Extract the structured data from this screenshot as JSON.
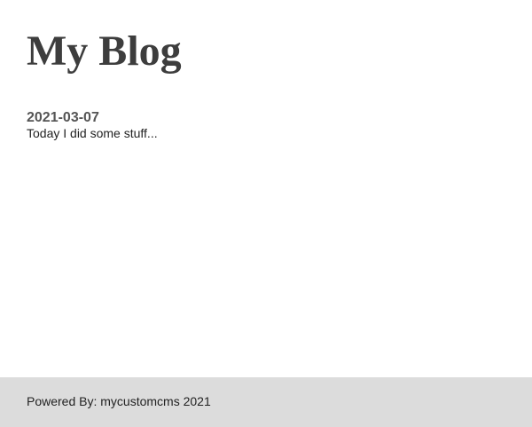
{
  "header": {
    "title": "My Blog"
  },
  "posts": [
    {
      "date": "2021-03-07",
      "body": "Today I did some stuff..."
    }
  ],
  "footer": {
    "text": "Powered By: mycustomcms 2021"
  },
  "colors": {
    "title": "#3d3d3d",
    "date": "#555555",
    "text": "#222222",
    "footer_background": "#dcdcdc",
    "page_background": "#ffffff"
  }
}
